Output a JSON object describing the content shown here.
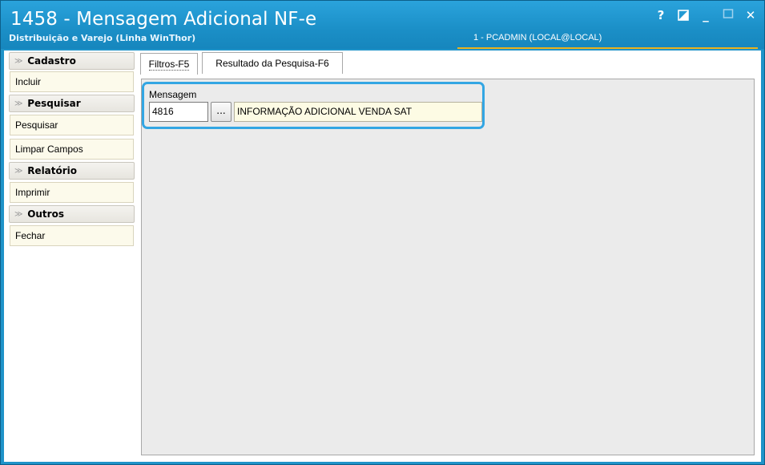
{
  "window": {
    "title": "1458 - Mensagem Adicional NF-e",
    "subtitle": "Distribuição e Varejo (Linha WinThor)",
    "user": "1 - PCADMIN (LOCAL@LOCAL)",
    "controls": {
      "help": "?",
      "minimize": "_",
      "close": "✕"
    },
    "colors": {
      "titlebar": "#1f93c9",
      "accent": "#e9b21c",
      "highlight": "#33a6e3"
    }
  },
  "sidebar": {
    "sections": [
      {
        "title": "Cadastro",
        "items": [
          "Incluir"
        ]
      },
      {
        "title": "Pesquisar",
        "items": [
          "Pesquisar",
          "Limpar Campos"
        ]
      },
      {
        "title": "Relatório",
        "items": [
          "Imprimir"
        ]
      },
      {
        "title": "Outros",
        "items": [
          "Fechar"
        ]
      }
    ],
    "chevron": "≫"
  },
  "tabs": [
    {
      "label": "Filtros-F5",
      "active": true
    },
    {
      "label": "Resultado da Pesquisa-F6",
      "active": false
    }
  ],
  "filters": {
    "mensagem_label": "Mensagem",
    "code_value": "4816",
    "lookup_label": "...",
    "description_value": "INFORMAÇÃO ADICIONAL VENDA SAT"
  }
}
